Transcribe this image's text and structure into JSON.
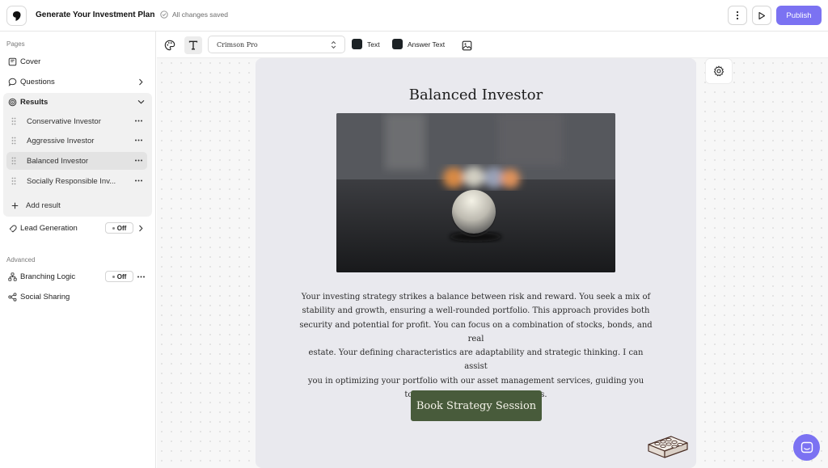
{
  "header": {
    "title": "Generate Your Investment Plan",
    "save_status": "All changes saved",
    "publish_label": "Publish"
  },
  "sidebar": {
    "pages_label": "Pages",
    "advanced_label": "Advanced",
    "items": [
      {
        "label": "Cover"
      },
      {
        "label": "Questions"
      },
      {
        "label": "Results"
      }
    ],
    "results": [
      {
        "label": "Conservative Investor"
      },
      {
        "label": "Aggressive Investor"
      },
      {
        "label": "Balanced Investor"
      },
      {
        "label": "Socially Responsible Inv..."
      }
    ],
    "add_result_label": "Add result",
    "lead_generation": {
      "label": "Lead Generation",
      "toggle": "Off"
    },
    "branching_logic": {
      "label": "Branching Logic",
      "toggle": "Off"
    },
    "social_sharing": {
      "label": "Social Sharing"
    }
  },
  "toolbar": {
    "font": "Crimson Pro",
    "text_color_label": "Text",
    "answer_color_label": "Answer Text",
    "text_color": "#1c2225"
  },
  "result_card": {
    "title": "Balanced Investor",
    "body_lines": [
      "Your investing strategy strikes a balance between risk and reward. You seek a mix of",
      "stability and growth, ensuring a well-rounded portfolio. This approach provides both",
      "security and potential for profit. You can focus on a combination of stocks, bonds, and real",
      "estate. Your defining characteristics are adaptability and strategic thinking. I can assist",
      "you in optimizing your portfolio with our asset management services, guiding you",
      "towards your financial aspirations."
    ],
    "cta_label": "Book Strategy Session",
    "button_color": "#485b3b"
  },
  "colors": {
    "accent": "#7b72f2",
    "card_bg": "#e9e9ee"
  }
}
